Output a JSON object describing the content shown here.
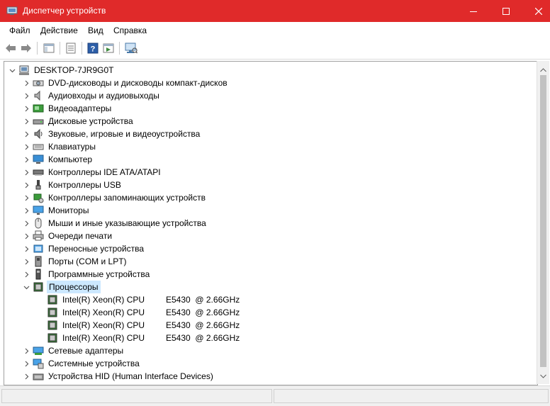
{
  "window": {
    "title": "Диспетчер устройств"
  },
  "menu": {
    "items": [
      "Файл",
      "Действие",
      "Вид",
      "Справка"
    ]
  },
  "toolbar": {
    "buttons": [
      "back-arrow-icon",
      "forward-arrow-icon",
      "show-hide-tree-icon",
      "properties-icon",
      "help-icon",
      "run-icon",
      "scan-hardware-icon"
    ]
  },
  "tree": {
    "root": "DESKTOP-7JR9G0T",
    "categories": [
      {
        "label": "DVD-дисководы и дисководы компакт-дисков",
        "icon": "dvd-drive-icon"
      },
      {
        "label": "Аудиовходы и аудиовыходы",
        "icon": "speaker-icon"
      },
      {
        "label": "Видеоадаптеры",
        "icon": "display-adapter-icon"
      },
      {
        "label": "Дисковые устройства",
        "icon": "disk-drive-icon"
      },
      {
        "label": "Звуковые, игровые и видеоустройства",
        "icon": "sound-device-icon"
      },
      {
        "label": "Клавиатуры",
        "icon": "keyboard-icon"
      },
      {
        "label": "Компьютер",
        "icon": "computer-icon"
      },
      {
        "label": "Контроллеры IDE ATA/ATAPI",
        "icon": "ide-controller-icon"
      },
      {
        "label": "Контроллеры USB",
        "icon": "usb-icon"
      },
      {
        "label": "Контроллеры запоминающих устройств",
        "icon": "storage-controller-icon"
      },
      {
        "label": "Мониторы",
        "icon": "monitor-icon"
      },
      {
        "label": "Мыши и иные указывающие устройства",
        "icon": "mouse-icon"
      },
      {
        "label": "Очереди печати",
        "icon": "printer-icon"
      },
      {
        "label": "Переносные устройства",
        "icon": "portable-device-icon"
      },
      {
        "label": "Порты (COM и LPT)",
        "icon": "port-icon"
      },
      {
        "label": "Программные устройства",
        "icon": "software-device-icon"
      },
      {
        "label": "Процессоры",
        "icon": "processor-icon",
        "expanded": true,
        "selected": true
      }
    ],
    "processors": [
      {
        "name": "Intel(R) Xeon(R) CPU",
        "model": "E5430  @ 2.66GHz"
      },
      {
        "name": "Intel(R) Xeon(R) CPU",
        "model": "E5430  @ 2.66GHz"
      },
      {
        "name": "Intel(R) Xeon(R) CPU",
        "model": "E5430  @ 2.66GHz"
      },
      {
        "name": "Intel(R) Xeon(R) CPU",
        "model": "E5430  @ 2.66GHz"
      }
    ],
    "categories_after": [
      {
        "label": "Сетевые адаптеры",
        "icon": "network-adapter-icon"
      },
      {
        "label": "Системные устройства",
        "icon": "system-device-icon"
      },
      {
        "label": "Устройства HID (Human Interface Devices)",
        "icon": "hid-device-icon"
      }
    ]
  },
  "colors": {
    "titlebar": "#e02a2a",
    "selection": "#cce8ff"
  }
}
